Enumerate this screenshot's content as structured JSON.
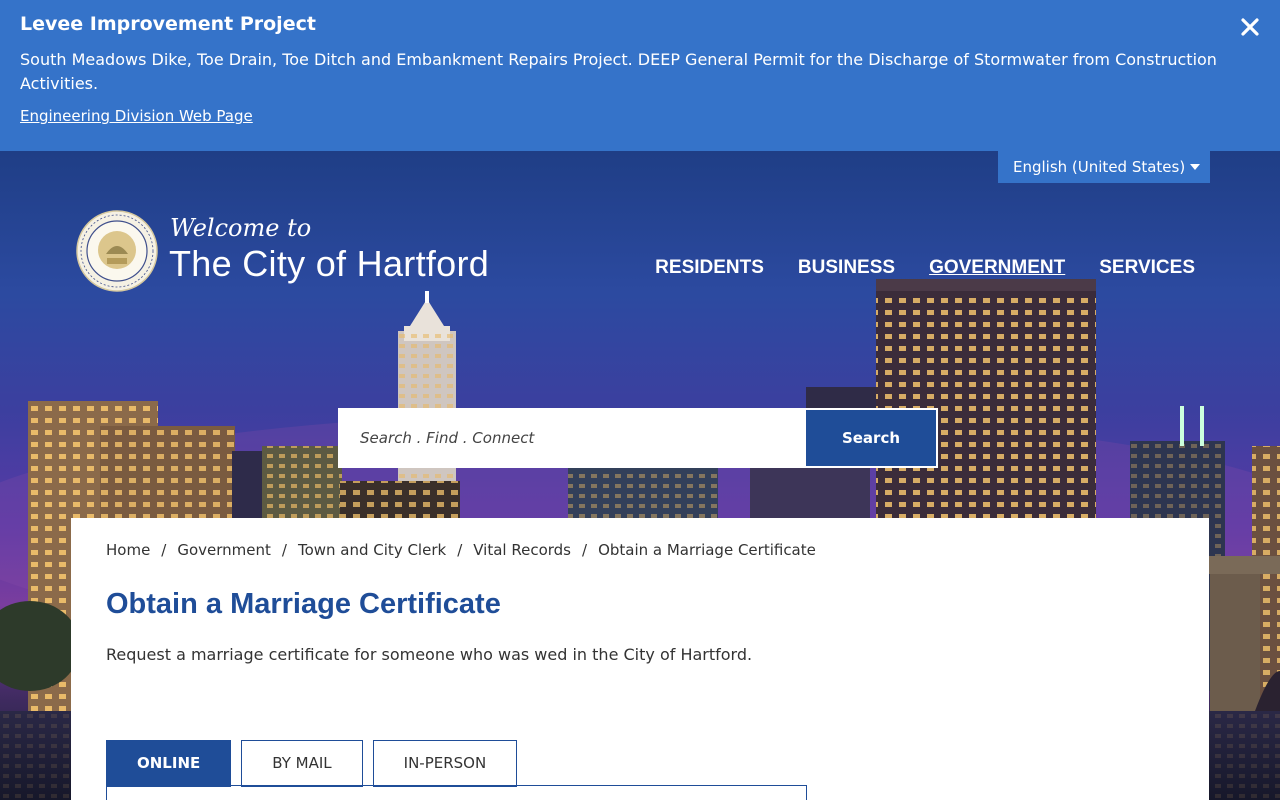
{
  "alert": {
    "title": "Levee Improvement Project",
    "text": "South Meadows Dike, Toe Drain, Toe Ditch and Embankment Repairs Project. DEEP General Permit for the Discharge of Stormwater from Construction Activities.",
    "link_label": "Engineering Division Web Page",
    "close_icon": "close-icon"
  },
  "language": {
    "selected": "English (United States)"
  },
  "header": {
    "welcome": "Welcome to",
    "city_name": "The City of Hartford"
  },
  "nav": {
    "items": [
      {
        "label": "RESIDENTS"
      },
      {
        "label": "BUSINESS"
      },
      {
        "label": "GOVERNMENT"
      },
      {
        "label": "SERVICES"
      }
    ],
    "active": "GOVERNMENT"
  },
  "search": {
    "placeholder": "Search . Find . Connect",
    "button_label": "Search"
  },
  "breadcrumb": {
    "items": [
      "Home",
      "Government",
      "Town and City Clerk",
      "Vital Records",
      "Obtain a Marriage Certificate"
    ]
  },
  "page": {
    "title": "Obtain a Marriage Certificate",
    "intro": "Request a marriage certificate for someone who was wed in the City of Hartford."
  },
  "tabs": {
    "items": [
      {
        "label": "ONLINE"
      },
      {
        "label": "BY MAIL"
      },
      {
        "label": "IN-PERSON"
      }
    ],
    "active": "ONLINE"
  },
  "colors": {
    "alert_bg": "#3573c9",
    "brand_blue": "#1f4d98",
    "white": "#ffffff"
  }
}
